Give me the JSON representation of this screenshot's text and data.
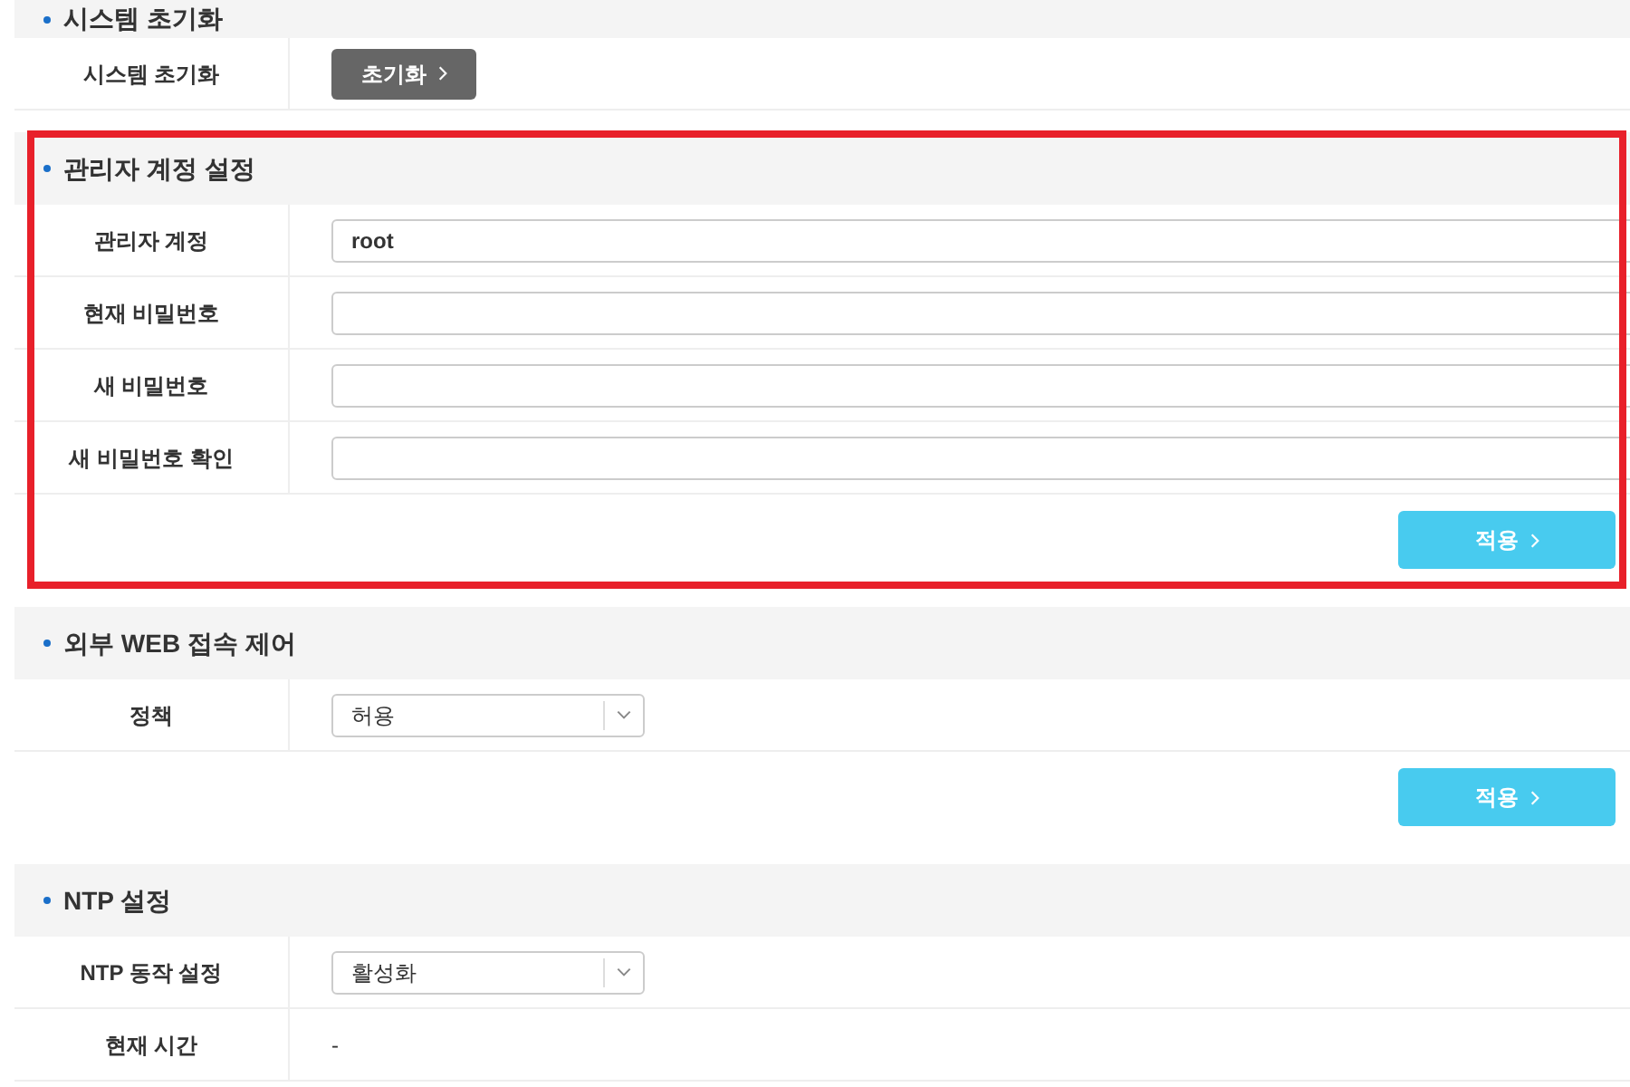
{
  "sections": [
    {
      "title": "시스템 초기화",
      "highlighted": false,
      "rows": [
        {
          "kind": "button",
          "label": "시스템 초기화",
          "button": "초기화"
        }
      ]
    },
    {
      "title": "관리자 계정 설정",
      "highlighted": true,
      "rows": [
        {
          "kind": "input",
          "label": "관리자 계정",
          "value": "root"
        },
        {
          "kind": "input",
          "label": "현재 비밀번호"
        },
        {
          "kind": "input",
          "label": "새 비밀번호"
        },
        {
          "kind": "input",
          "label": "새 비밀번호 확인"
        }
      ],
      "apply_button": "적용"
    },
    {
      "title": "외부 WEB 접속 제어",
      "highlighted": false,
      "rows": [
        {
          "kind": "select",
          "label": "정책",
          "value": "허용"
        }
      ],
      "apply_button": "적용"
    },
    {
      "title": "NTP 설정",
      "highlighted": false,
      "rows": [
        {
          "kind": "select",
          "label": "NTP 동작 설정",
          "value": "활성화"
        },
        {
          "kind": "text",
          "label": "현재 시간",
          "value": "-"
        }
      ]
    }
  ]
}
